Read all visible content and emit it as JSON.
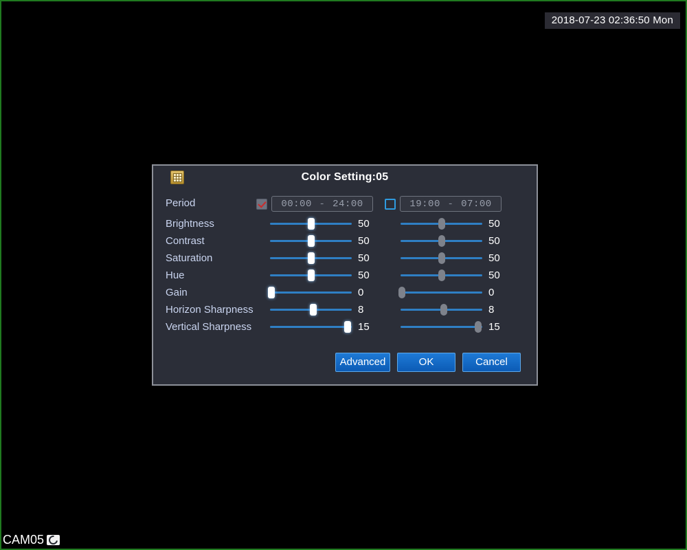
{
  "osd": {
    "timestamp": "2018-07-23 02:36:50 Mon",
    "channel_label": "CAM05",
    "record_icon": "record-camera-icon"
  },
  "dialog": {
    "title": "Color Setting:05",
    "title_icon": "grid-icon",
    "period": {
      "label": "Period",
      "schedule1": {
        "checked": true,
        "start": "00:00",
        "separator": "-",
        "end": "24:00"
      },
      "schedule2": {
        "checked": false,
        "start": "19:00",
        "separator": "-",
        "end": "07:00"
      }
    },
    "settings": [
      {
        "label": "Brightness",
        "left_value": "50",
        "left_pct": 50,
        "right_value": "50",
        "right_pct": 50
      },
      {
        "label": "Contrast",
        "left_value": "50",
        "left_pct": 50,
        "right_value": "50",
        "right_pct": 50
      },
      {
        "label": "Saturation",
        "left_value": "50",
        "left_pct": 50,
        "right_value": "50",
        "right_pct": 50
      },
      {
        "label": "Hue",
        "left_value": "50",
        "left_pct": 50,
        "right_value": "50",
        "right_pct": 50
      },
      {
        "label": "Gain",
        "left_value": "0",
        "left_pct": 2,
        "right_value": "0",
        "right_pct": 2
      },
      {
        "label": "Horizon Sharpness",
        "left_value": "8",
        "left_pct": 53,
        "right_value": "8",
        "right_pct": 53
      },
      {
        "label": "Vertical Sharpness",
        "left_value": "15",
        "left_pct": 95,
        "right_value": "15",
        "right_pct": 95
      }
    ],
    "buttons": {
      "advanced": "Advanced",
      "ok": "OK",
      "cancel": "Cancel"
    }
  },
  "colors": {
    "screen_border": "#1f7a1f",
    "dialog_bg": "#2b2e38",
    "dialog_border": "#8d9099",
    "label_text": "#c9d4ef",
    "slider_track": "#2f7fc4",
    "knob_active": "#ffffff",
    "knob_inactive": "#7e828b",
    "button_blue": "#1273d4",
    "check_red": "#cc2a2a",
    "checkbox_outline_blue": "#2f9be0",
    "title_icon_gold": "#d4ad4a"
  }
}
